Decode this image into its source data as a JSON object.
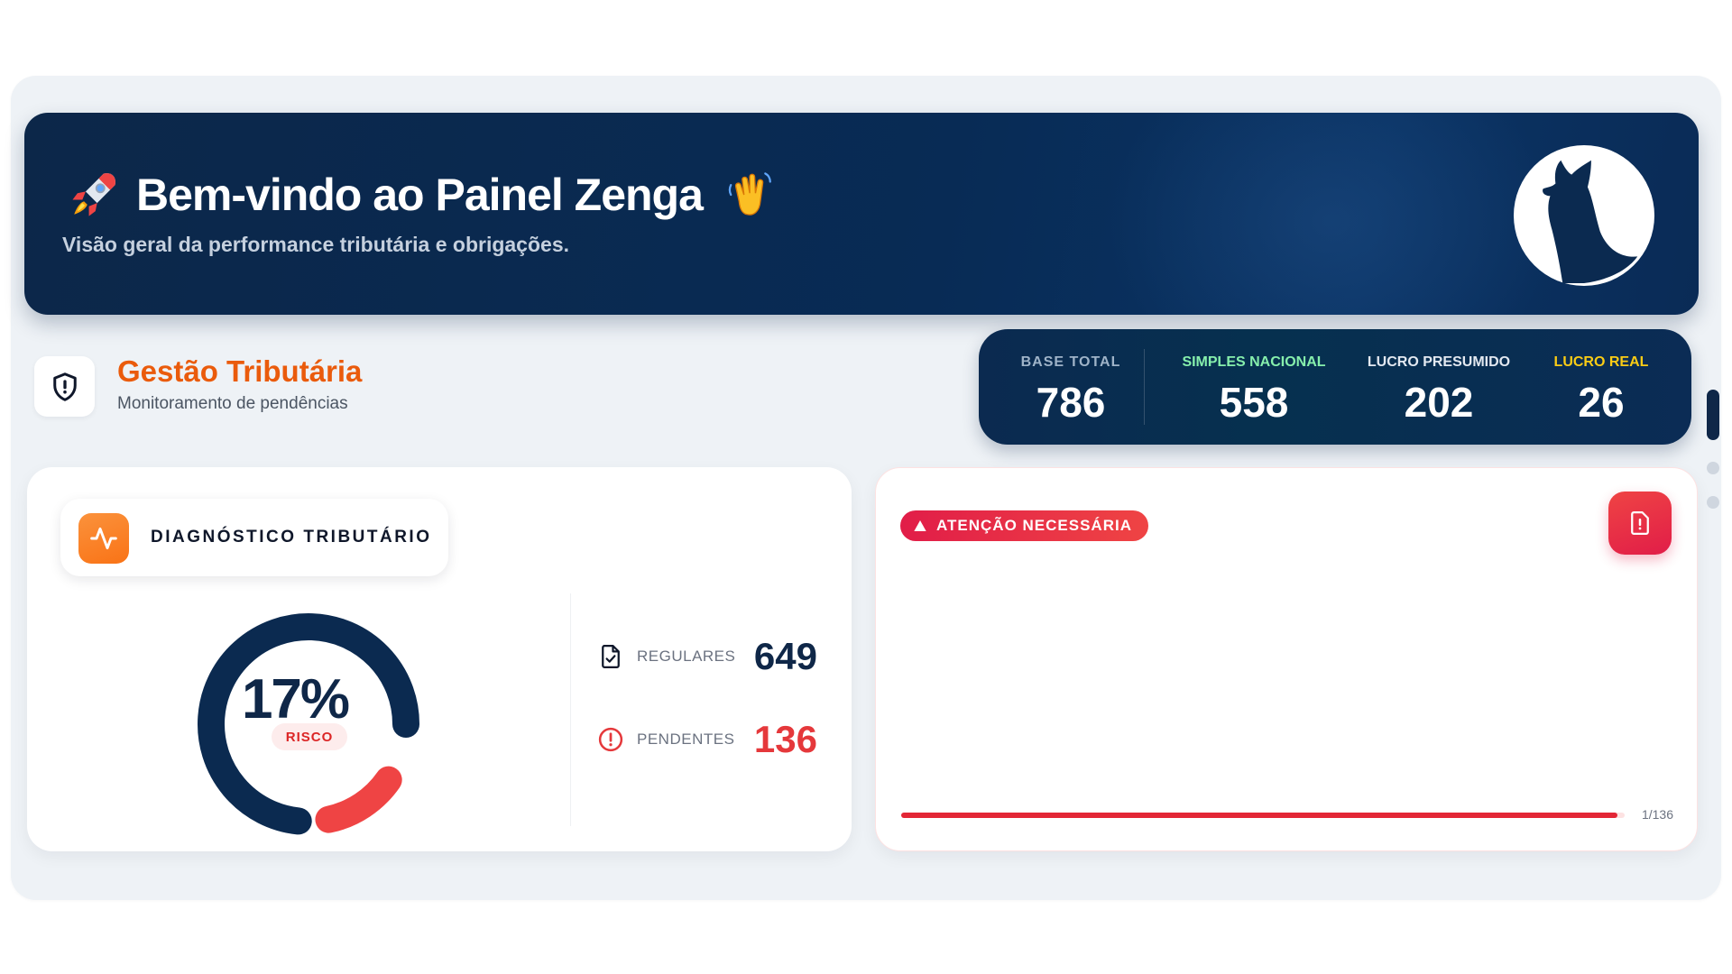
{
  "banner": {
    "title": "Bem-vindo ao Painel Zenga",
    "subtitle": "Visão geral da performance tributária e obrigações."
  },
  "section": {
    "title": "Gestão Tributária",
    "subtitle": "Monitoramento de pendências"
  },
  "stats": [
    {
      "label": "BASE TOTAL",
      "value": "786",
      "color": "#9fb3c8"
    },
    {
      "label": "SIMPLES NACIONAL",
      "value": "558",
      "color": "#86efac"
    },
    {
      "label": "LUCRO PRESUMIDO",
      "value": "202",
      "color": "#e2e8f0"
    },
    {
      "label": "LUCRO REAL",
      "value": "26",
      "color": "#facc15"
    }
  ],
  "diagnostico": {
    "label": "DIAGNÓSTICO TRIBUTÁRIO",
    "percent": "17%",
    "risk_label": "RISCO",
    "risk_fraction": 0.17,
    "metrics": [
      {
        "label": "REGULARES",
        "value": "649",
        "color": "#0f2748",
        "icon": "file-check-icon"
      },
      {
        "label": "PENDENTES",
        "value": "136",
        "color": "#e5383b",
        "icon": "alert-circle-icon"
      }
    ]
  },
  "alert": {
    "label": "ATENÇÃO NECESSÁRIA",
    "progress_label": "1/136",
    "progress_fraction": 0.99
  },
  "colors": {
    "navy": "#0f2748",
    "orange": "#ea5b0c",
    "red": "#e11d48"
  }
}
